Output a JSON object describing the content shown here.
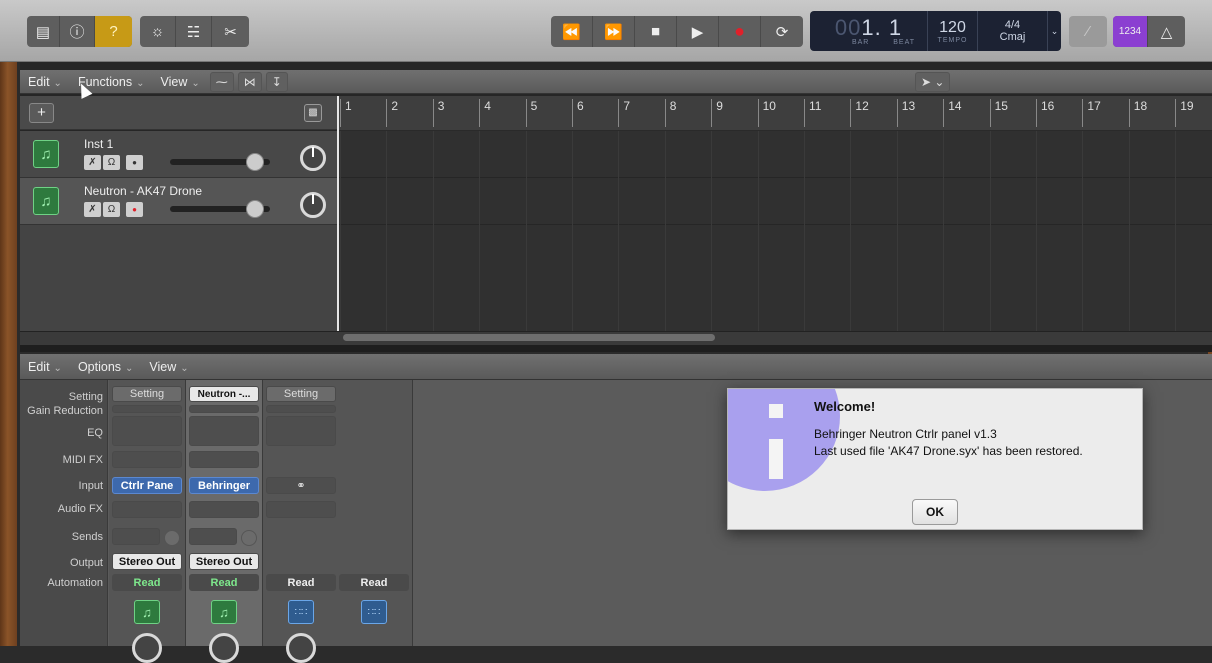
{
  "toolbar": {
    "left_icons": [
      "library-icon",
      "info-icon",
      "help-icon",
      "smart-controls-icon",
      "mixer-icon",
      "editors-icon"
    ],
    "transport": [
      "rewind-icon",
      "fast-forward-icon",
      "stop-icon",
      "play-icon",
      "record-icon",
      "cycle-icon"
    ],
    "lcd": {
      "position_dim": "00",
      "position": "1. 1",
      "bar_label": "BAR",
      "beat_label": "BEAT",
      "tempo": "120",
      "tempo_label": "TEMPO",
      "signature": "4/4",
      "key": "Cmaj"
    },
    "count_in": "1234"
  },
  "tracks_menu": {
    "edit": "Edit",
    "functions": "Functions",
    "view": "View"
  },
  "tracks": [
    {
      "name": "Inst 1",
      "record_armed": false
    },
    {
      "name": "Neutron - AK47 Drone",
      "record_armed": true
    }
  ],
  "ruler": [
    "1",
    "2",
    "3",
    "4",
    "5",
    "6",
    "7",
    "8",
    "9",
    "10",
    "11",
    "12",
    "13",
    "14",
    "15",
    "16",
    "17",
    "18",
    "19"
  ],
  "mixer_menu": {
    "edit": "Edit",
    "options": "Options",
    "view": "View"
  },
  "mixer_labels": {
    "setting": "Setting",
    "gain_reduction": "Gain Reduction",
    "eq": "EQ",
    "midi_fx": "MIDI FX",
    "input": "Input",
    "audio_fx": "Audio FX",
    "sends": "Sends",
    "output": "Output",
    "automation": "Automation"
  },
  "strips": [
    {
      "setting": "Setting",
      "input": "Ctrlr Pane",
      "output": "Stereo Out",
      "automation": "Read"
    },
    {
      "setting": "Neutron -...",
      "input": "Behringer",
      "output": "Stereo Out",
      "automation": "Read"
    },
    {
      "setting": "Setting",
      "input": "⚭",
      "automation": "Read"
    },
    {
      "automation": "Read"
    }
  ],
  "dialog": {
    "title": "Welcome!",
    "line1": "Behringer Neutron Ctrlr panel v1.3",
    "line2": "Last used file 'AK47 Drone.syx' has been restored.",
    "ok": "OK"
  },
  "colors": {
    "accent_green": "#7ee88c",
    "input_blue": "#3d69ad",
    "record_red": "#e0202a",
    "count_in_purple": "#8b3fd1",
    "dialog_icon": "#a9a0ee"
  }
}
